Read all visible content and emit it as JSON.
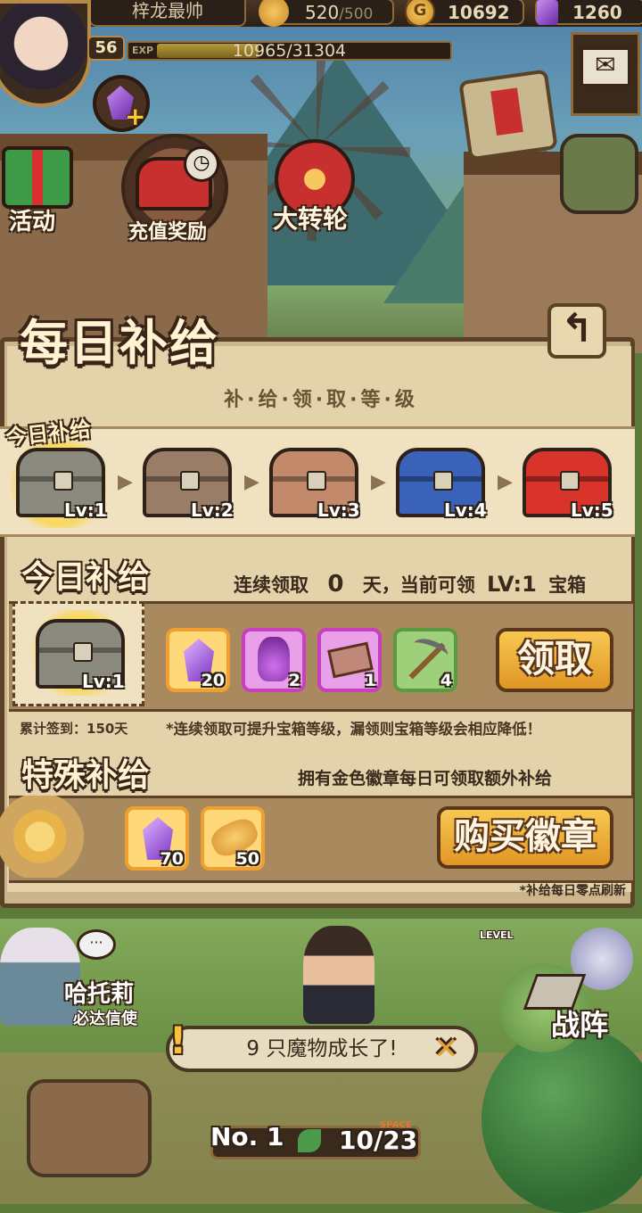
{
  "top_bar": {
    "player_name": "梓龙最帅",
    "bread": "520",
    "bread_max": "/500",
    "gold": "10692",
    "gems": "1260",
    "level": "56",
    "exp_label": "EXP",
    "exp_text": "10965/31304",
    "exp_progress": 0.35
  },
  "menu": {
    "activity": "活动",
    "recharge": "充值奖励",
    "wheel": "大转轮"
  },
  "panel": {
    "title": "每日补给",
    "subheader": "补·给·领·取·等·级",
    "today_badge": "今日补给",
    "chests": [
      {
        "label": "Lv:1",
        "color": "#8a8a7e"
      },
      {
        "label": "Lv:2",
        "color": "#9a7d66"
      },
      {
        "label": "Lv:3",
        "color": "#c28a6a"
      },
      {
        "label": "Lv:4",
        "color": "#3a62b8"
      },
      {
        "label": "Lv:5",
        "color": "#d8342c"
      }
    ],
    "today_section": {
      "title": "今日补给",
      "streak_prefix": "连续领取",
      "streak_days": "0",
      "streak_suffix": "天，当前可领",
      "current_level": "LV:1",
      "chest_word": "宝箱",
      "chest_label": "Lv:1",
      "claim_button": "领取",
      "rewards": [
        {
          "icon": "purple-gem-icon",
          "count": "20",
          "border": "#f0a030",
          "bg": "#ffd87a"
        },
        {
          "icon": "potion-vase-icon",
          "count": "2",
          "border": "#c840c0",
          "bg": "#e8a0e8"
        },
        {
          "icon": "ticket-icon",
          "count": "1",
          "border": "#c840c0",
          "bg": "#e8a0e8"
        },
        {
          "icon": "pickaxe-icon",
          "count": "4",
          "border": "#5a9a40",
          "bg": "#9ed07a"
        }
      ]
    },
    "total_signin": "累计签到：150天",
    "warning": "*连续领取可提升宝箱等级，漏领则宝箱等级会相应降低！",
    "special_section": {
      "title": "特殊补给",
      "desc": "拥有金色徽章每日可领取额外补给",
      "rewards": [
        {
          "icon": "purple-gem-icon",
          "count": "70"
        },
        {
          "icon": "bread-icon",
          "count": "50"
        }
      ],
      "buy_button": "购买徽章"
    },
    "refresh_note": "*补给每日零点刷新"
  },
  "hud": {
    "npc_name": "哈托莉",
    "npc_role": "必达信使",
    "formation": "战阵",
    "notification": "9 只魔物成长了!",
    "floor_label": "No. 1",
    "capacity": "10/23",
    "space_label": "SPACE",
    "level_tag": "LEVEL"
  }
}
